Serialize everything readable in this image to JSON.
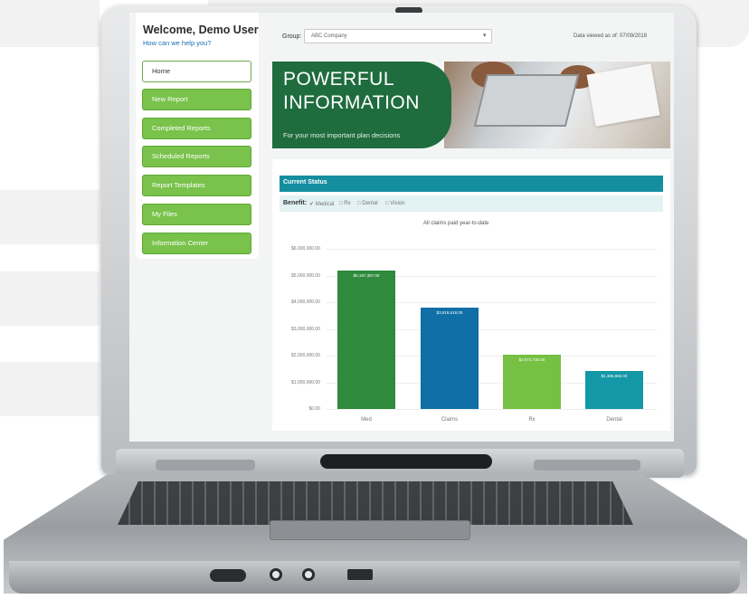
{
  "sidebar": {
    "welcome": "Welcome, Demo User",
    "help": "How can we help you?",
    "items": [
      {
        "label": "Home"
      },
      {
        "label": "New Report"
      },
      {
        "label": "Completed Reports"
      },
      {
        "label": "Scheduled Reports"
      },
      {
        "label": "Report Templates"
      },
      {
        "label": "My Files"
      },
      {
        "label": "Information Center"
      }
    ]
  },
  "header": {
    "group_label": "Group:",
    "group_value": "ABC Company",
    "data_as_of": "Data viewed as of: 07/09/2018"
  },
  "banner": {
    "line1": "POWERFUL",
    "line2": "INFORMATION",
    "subtitle": "For your most important plan decisions"
  },
  "panel": {
    "title": "Current Status",
    "benefit_label": "Benefit:",
    "benefit_options": [
      "Medical",
      "Rx",
      "Dental",
      "Vision"
    ],
    "benefit_checked": [
      true,
      false,
      false,
      false
    ]
  },
  "colors": {
    "nav_green": "#79c24b",
    "banner_green": "#1f6c3e",
    "panel_teal": "#158fa0"
  },
  "chart_data": {
    "type": "bar",
    "title": "All claims paid year-to-date",
    "y_ticks": [
      "$0.00",
      "$1,000,000.00",
      "$2,000,000.00",
      "$3,000,000.00",
      "$4,000,000.00",
      "$5,000,000.00",
      "$6,000,000.00"
    ],
    "ylim": [
      0,
      6000000
    ],
    "categories": [
      "Med",
      "Claims",
      "Rx",
      "Dental"
    ],
    "values": [
      5200000,
      3800000,
      2025000,
      1430000
    ],
    "value_labels": [
      "$5,187,387.00",
      "$3,818,518.00",
      "$2,074,730.00",
      "$1,396,665.00"
    ],
    "colors": [
      "#2f8a3d",
      "#0f6fa6",
      "#76c043",
      "#1497a6"
    ]
  }
}
